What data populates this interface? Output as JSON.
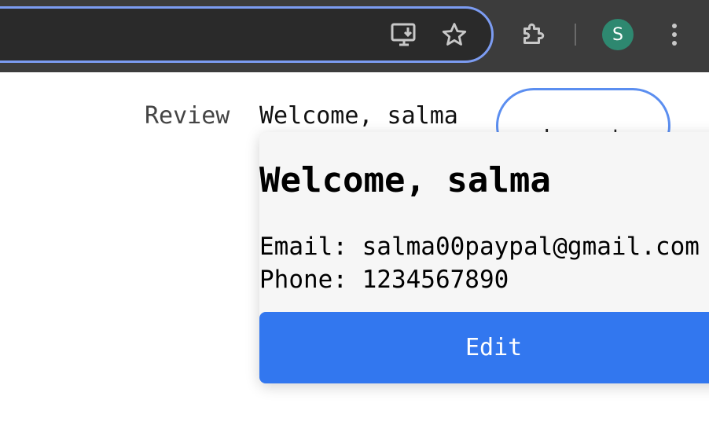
{
  "browser": {
    "install_icon": "install-app-icon",
    "bookmark_icon": "star-icon",
    "extensions_icon": "puzzle-icon",
    "avatar_initial": "S",
    "menu_icon": "kebab-menu-icon"
  },
  "nav": {
    "review_label": "Review",
    "welcome_text": "Welcome, salma",
    "logout_label": "Logout"
  },
  "profile": {
    "title": "Welcome, salma",
    "email_line": "Email: salma00paypal@gmail.com",
    "phone_line": "Phone: 1234567890",
    "edit_label": "Edit"
  },
  "colors": {
    "toolbar_bg": "#3c3c3c",
    "omnibox_border": "#7c9cf2",
    "avatar_bg": "#2e8870",
    "logout_border": "#5b8ef0",
    "edit_bg": "#3277ef"
  }
}
